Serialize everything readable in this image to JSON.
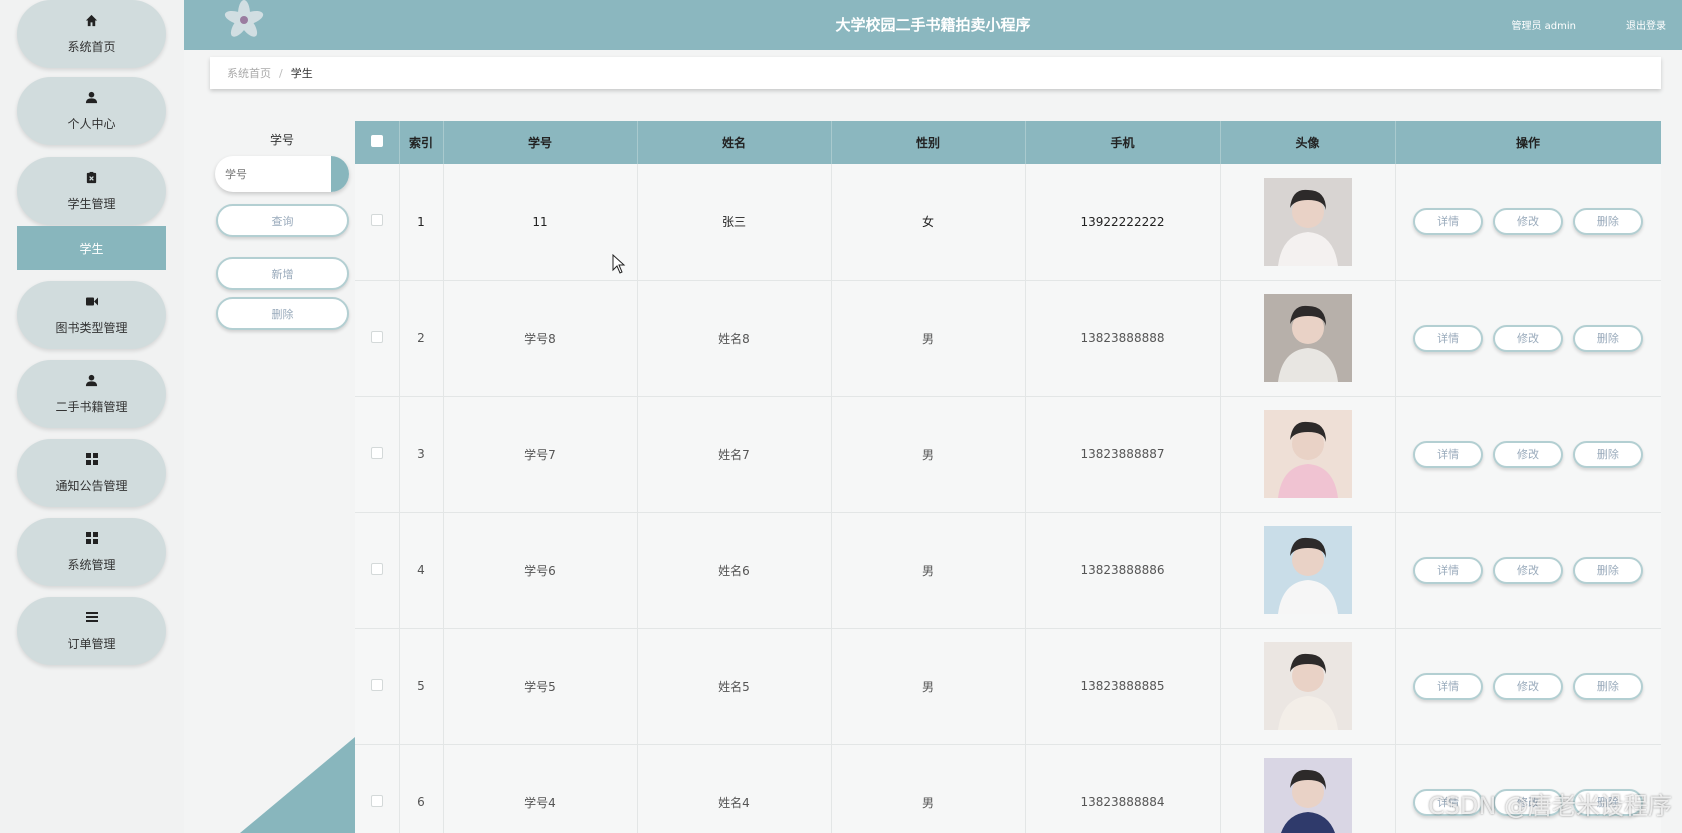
{
  "app": {
    "title": "大学校园二手书籍拍卖小程序",
    "user_label": "管理员 admin",
    "logout_label": "退出登录"
  },
  "sidebar": {
    "items": [
      {
        "label": "系统首页",
        "icon": "home-icon"
      },
      {
        "label": "个人中心",
        "icon": "user-icon"
      },
      {
        "label": "学生管理",
        "icon": "clipboard-icon"
      },
      {
        "label": "图书类型管理",
        "icon": "video-icon"
      },
      {
        "label": "二手书籍管理",
        "icon": "user-icon"
      },
      {
        "label": "通知公告管理",
        "icon": "grid-icon"
      },
      {
        "label": "系统管理",
        "icon": "grid-icon"
      },
      {
        "label": "订单管理",
        "icon": "list-icon"
      }
    ],
    "active_sub": "学生"
  },
  "breadcrumb": {
    "home": "系统首页",
    "separator": "/",
    "current": "学生"
  },
  "search": {
    "label": "学号",
    "placeholder": "学号",
    "query_button": "查询",
    "add_button": "新增",
    "delete_button": "删除"
  },
  "table": {
    "headers": [
      "索引",
      "学号",
      "姓名",
      "性别",
      "手机",
      "头像",
      "操作"
    ],
    "actions": {
      "detail": "详情",
      "edit": "修改",
      "delete": "删除"
    },
    "rows": [
      {
        "index": "1",
        "student_id": "11",
        "name": "张三",
        "gender": "女",
        "phone": "13922222222"
      },
      {
        "index": "2",
        "student_id": "学号8",
        "name": "姓名8",
        "gender": "男",
        "phone": "13823888888"
      },
      {
        "index": "3",
        "student_id": "学号7",
        "name": "姓名7",
        "gender": "男",
        "phone": "13823888887"
      },
      {
        "index": "4",
        "student_id": "学号6",
        "name": "姓名6",
        "gender": "男",
        "phone": "13823888886"
      },
      {
        "index": "5",
        "student_id": "学号5",
        "name": "姓名5",
        "gender": "男",
        "phone": "13823888885"
      },
      {
        "index": "6",
        "student_id": "学号4",
        "name": "姓名4",
        "gender": "男",
        "phone": "13823888884"
      }
    ]
  },
  "watermark": "CSDN @唐老米设程序",
  "colors": {
    "accent": "#88b6bd",
    "header_bg": "#8bb7bf",
    "nav_bg": "#d1dcdd"
  }
}
